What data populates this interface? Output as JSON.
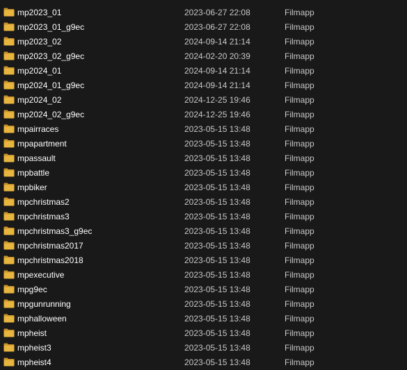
{
  "colors": {
    "background": "#191919",
    "folder_body": "#E8B53F",
    "folder_back": "#C9932A",
    "name_text": "#ffffff",
    "meta_text": "#c8c8c8"
  },
  "rows": [
    {
      "name": "mp2023_01",
      "date": "2023-06-27 22:08",
      "type": "Filmapp",
      "icon": "folder-icon"
    },
    {
      "name": "mp2023_01_g9ec",
      "date": "2023-06-27 22:08",
      "type": "Filmapp",
      "icon": "folder-icon"
    },
    {
      "name": "mp2023_02",
      "date": "2024-09-14 21:14",
      "type": "Filmapp",
      "icon": "folder-icon"
    },
    {
      "name": "mp2023_02_g9ec",
      "date": "2024-02-20 20:39",
      "type": "Filmapp",
      "icon": "folder-icon"
    },
    {
      "name": "mp2024_01",
      "date": "2024-09-14 21:14",
      "type": "Filmapp",
      "icon": "folder-icon"
    },
    {
      "name": "mp2024_01_g9ec",
      "date": "2024-09-14 21:14",
      "type": "Filmapp",
      "icon": "folder-icon"
    },
    {
      "name": "mp2024_02",
      "date": "2024-12-25 19:46",
      "type": "Filmapp",
      "icon": "folder-icon"
    },
    {
      "name": "mp2024_02_g9ec",
      "date": "2024-12-25 19:46",
      "type": "Filmapp",
      "icon": "folder-icon"
    },
    {
      "name": "mpairraces",
      "date": "2023-05-15 13:48",
      "type": "Filmapp",
      "icon": "folder-icon"
    },
    {
      "name": "mpapartment",
      "date": "2023-05-15 13:48",
      "type": "Filmapp",
      "icon": "folder-icon"
    },
    {
      "name": "mpassault",
      "date": "2023-05-15 13:48",
      "type": "Filmapp",
      "icon": "folder-icon"
    },
    {
      "name": "mpbattle",
      "date": "2023-05-15 13:48",
      "type": "Filmapp",
      "icon": "folder-icon"
    },
    {
      "name": "mpbiker",
      "date": "2023-05-15 13:48",
      "type": "Filmapp",
      "icon": "folder-icon"
    },
    {
      "name": "mpchristmas2",
      "date": "2023-05-15 13:48",
      "type": "Filmapp",
      "icon": "folder-icon"
    },
    {
      "name": "mpchristmas3",
      "date": "2023-05-15 13:48",
      "type": "Filmapp",
      "icon": "folder-icon"
    },
    {
      "name": "mpchristmas3_g9ec",
      "date": "2023-05-15 13:48",
      "type": "Filmapp",
      "icon": "folder-icon"
    },
    {
      "name": "mpchristmas2017",
      "date": "2023-05-15 13:48",
      "type": "Filmapp",
      "icon": "folder-icon"
    },
    {
      "name": "mpchristmas2018",
      "date": "2023-05-15 13:48",
      "type": "Filmapp",
      "icon": "folder-icon"
    },
    {
      "name": "mpexecutive",
      "date": "2023-05-15 13:48",
      "type": "Filmapp",
      "icon": "folder-icon"
    },
    {
      "name": "mpg9ec",
      "date": "2023-05-15 13:48",
      "type": "Filmapp",
      "icon": "folder-icon"
    },
    {
      "name": "mpgunrunning",
      "date": "2023-05-15 13:48",
      "type": "Filmapp",
      "icon": "folder-icon"
    },
    {
      "name": "mphalloween",
      "date": "2023-05-15 13:48",
      "type": "Filmapp",
      "icon": "folder-icon"
    },
    {
      "name": "mpheist",
      "date": "2023-05-15 13:48",
      "type": "Filmapp",
      "icon": "folder-icon"
    },
    {
      "name": "mpheist3",
      "date": "2023-05-15 13:48",
      "type": "Filmapp",
      "icon": "folder-icon"
    },
    {
      "name": "mpheist4",
      "date": "2023-05-15 13:48",
      "type": "Filmapp",
      "icon": "folder-icon"
    }
  ]
}
